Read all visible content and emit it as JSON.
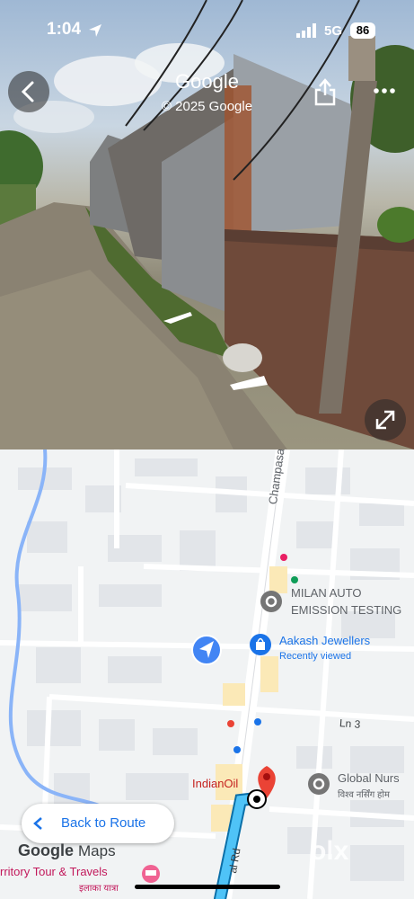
{
  "status_bar": {
    "time": "1:04",
    "network": "5G",
    "battery": "86"
  },
  "street_view": {
    "title": "Google",
    "copyright": "© 2025 Google"
  },
  "map": {
    "street_name": "Champasari",
    "road_name_bottom": "al Rd",
    "poi_milan_line1": "MILAN AUTO",
    "poi_milan_line2": "EMISSION TESTING",
    "poi_aakash": "Aakash Jewellers",
    "poi_aakash_sub": "Recently viewed",
    "poi_lane": "Ln 3",
    "poi_indianoil": "IndianOil",
    "poi_global": "Global Nurs",
    "poi_global_hindi": "विश्व नर्सिंग होम",
    "poi_tour": "rritory Tour & Travels",
    "poi_tour_hindi": "इलाका यात्रा",
    "back_to_route": "Back to Route",
    "google_maps_logo": {
      "google": "Google",
      "maps": "Maps"
    },
    "watermark": "olx"
  },
  "colors": {
    "route": "#4fc3f7",
    "pin": "#ea4335",
    "location_blue": "#4285f4"
  }
}
